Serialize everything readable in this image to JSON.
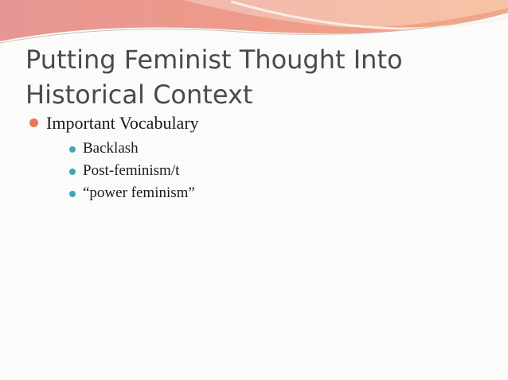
{
  "slide": {
    "title_lines": [
      "Putting Feminist Thought Into",
      "Historical Context"
    ],
    "bullets": [
      {
        "text": "Important Vocabulary",
        "sub_bullets": [
          "Backlash",
          "Post-feminism/t",
          "“power feminism”"
        ]
      }
    ]
  },
  "colors": {
    "header_band": "#ed8a80",
    "header_band_light": "#f6c2a4",
    "title_text": "#4a4a4a",
    "body_text": "#1a1a1a",
    "bullet_level1": "#e8785c",
    "bullet_level2": "#3fa6b9",
    "background": "#fbfbf9"
  }
}
